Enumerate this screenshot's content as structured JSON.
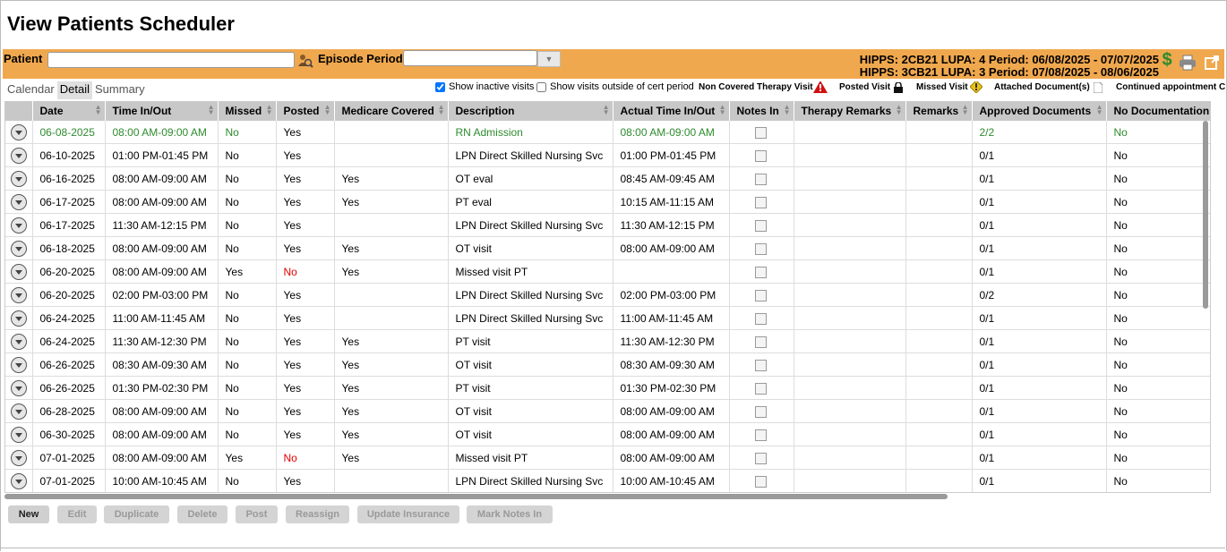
{
  "page": {
    "title": "View Patients Scheduler"
  },
  "filter": {
    "patient_label": "Patient",
    "patient_value": "",
    "episode_label": "Episode Period",
    "episode_value": "",
    "hipps_line1": "HIPPS: 2CB21 LUPA: 4 Period: 06/08/2025 - 07/07/2025",
    "hipps_line2": "HIPPS: 3CB21 LUPA: 3 Period: 07/08/2025 - 08/06/2025",
    "dollar_symbol": "$"
  },
  "tabs": [
    {
      "label": "Calendar",
      "active": false
    },
    {
      "label": "Detail",
      "active": true
    },
    {
      "label": "Summary",
      "active": false
    }
  ],
  "options": {
    "show_inactive_label": "Show inactive visits",
    "show_inactive_checked": true,
    "show_outside_label": "Show visits outside of cert period",
    "show_outside_checked": false,
    "legend_noncovered": "Non Covered Therapy Visit",
    "legend_posted": "Posted Visit",
    "legend_missed": "Missed Visit",
    "legend_attached": "Attached Document(s)",
    "legend_continued": "Continued appointment C"
  },
  "columns": [
    "Date",
    "Time In/Out",
    "Missed",
    "Posted",
    "Medicare Covered",
    "Description",
    "Actual Time In/Out",
    "Notes In",
    "Therapy Remarks",
    "Remarks",
    "Approved Documents",
    "No Documentation"
  ],
  "rows": [
    {
      "date": "06-08-2025",
      "time": "08:00 AM-09:00 AM",
      "missed": "No",
      "posted": "Yes",
      "medicare": "",
      "desc": "RN Admission",
      "actual": "08:00 AM-09:00 AM",
      "approved": "2/2",
      "nodoc": "No",
      "style": "green"
    },
    {
      "date": "06-10-2025",
      "time": "01:00 PM-01:45 PM",
      "missed": "No",
      "posted": "Yes",
      "medicare": "",
      "desc": "LPN Direct Skilled Nursing Svc",
      "actual": "01:00 PM-01:45 PM",
      "approved": "0/1",
      "nodoc": "No",
      "style": ""
    },
    {
      "date": "06-16-2025",
      "time": "08:00 AM-09:00 AM",
      "missed": "No",
      "posted": "Yes",
      "medicare": "Yes",
      "desc": "OT eval",
      "actual": "08:45 AM-09:45 AM",
      "approved": "0/1",
      "nodoc": "No",
      "style": ""
    },
    {
      "date": "06-17-2025",
      "time": "08:00 AM-09:00 AM",
      "missed": "No",
      "posted": "Yes",
      "medicare": "Yes",
      "desc": "PT eval",
      "actual": "10:15 AM-11:15 AM",
      "approved": "0/1",
      "nodoc": "No",
      "style": ""
    },
    {
      "date": "06-17-2025",
      "time": "11:30 AM-12:15 PM",
      "missed": "No",
      "posted": "Yes",
      "medicare": "",
      "desc": "LPN Direct Skilled Nursing Svc",
      "actual": "11:30 AM-12:15 PM",
      "approved": "0/1",
      "nodoc": "No",
      "style": ""
    },
    {
      "date": "06-18-2025",
      "time": "08:00 AM-09:00 AM",
      "missed": "No",
      "posted": "Yes",
      "medicare": "Yes",
      "desc": "OT visit",
      "actual": "08:00 AM-09:00 AM",
      "approved": "0/1",
      "nodoc": "No",
      "style": ""
    },
    {
      "date": "06-20-2025",
      "time": "08:00 AM-09:00 AM",
      "missed": "Yes",
      "posted": "No",
      "medicare": "Yes",
      "desc": "Missed visit PT",
      "actual": "",
      "approved": "0/1",
      "nodoc": "No",
      "style": "postedred"
    },
    {
      "date": "06-20-2025",
      "time": "02:00 PM-03:00 PM",
      "missed": "No",
      "posted": "Yes",
      "medicare": "",
      "desc": "LPN Direct Skilled Nursing Svc",
      "actual": "02:00 PM-03:00 PM",
      "approved": "0/2",
      "nodoc": "No",
      "style": ""
    },
    {
      "date": "06-24-2025",
      "time": "11:00 AM-11:45 AM",
      "missed": "No",
      "posted": "Yes",
      "medicare": "",
      "desc": "LPN Direct Skilled Nursing Svc",
      "actual": "11:00 AM-11:45 AM",
      "approved": "0/1",
      "nodoc": "No",
      "style": ""
    },
    {
      "date": "06-24-2025",
      "time": "11:30 AM-12:30 PM",
      "missed": "No",
      "posted": "Yes",
      "medicare": "Yes",
      "desc": "PT visit",
      "actual": "11:30 AM-12:30 PM",
      "approved": "0/1",
      "nodoc": "No",
      "style": ""
    },
    {
      "date": "06-26-2025",
      "time": "08:30 AM-09:30 AM",
      "missed": "No",
      "posted": "Yes",
      "medicare": "Yes",
      "desc": "OT visit",
      "actual": "08:30 AM-09:30 AM",
      "approved": "0/1",
      "nodoc": "No",
      "style": ""
    },
    {
      "date": "06-26-2025",
      "time": "01:30 PM-02:30 PM",
      "missed": "No",
      "posted": "Yes",
      "medicare": "Yes",
      "desc": "PT visit",
      "actual": "01:30 PM-02:30 PM",
      "approved": "0/1",
      "nodoc": "No",
      "style": ""
    },
    {
      "date": "06-28-2025",
      "time": "08:00 AM-09:00 AM",
      "missed": "No",
      "posted": "Yes",
      "medicare": "Yes",
      "desc": "OT visit",
      "actual": "08:00 AM-09:00 AM",
      "approved": "0/1",
      "nodoc": "No",
      "style": ""
    },
    {
      "date": "06-30-2025",
      "time": "08:00 AM-09:00 AM",
      "missed": "No",
      "posted": "Yes",
      "medicare": "Yes",
      "desc": "OT visit",
      "actual": "08:00 AM-09:00 AM",
      "approved": "0/1",
      "nodoc": "No",
      "style": ""
    },
    {
      "date": "07-01-2025",
      "time": "08:00 AM-09:00 AM",
      "missed": "Yes",
      "posted": "No",
      "medicare": "Yes",
      "desc": "Missed visit PT",
      "actual": "08:00 AM-09:00 AM",
      "approved": "0/1",
      "nodoc": "No",
      "style": "postedred"
    },
    {
      "date": "07-01-2025",
      "time": "10:00 AM-10:45 AM",
      "missed": "No",
      "posted": "Yes",
      "medicare": "",
      "desc": "LPN Direct Skilled Nursing Svc",
      "actual": "10:00 AM-10:45 AM",
      "approved": "0/1",
      "nodoc": "No",
      "style": ""
    }
  ],
  "buttons": [
    {
      "label": "New",
      "enabled": true
    },
    {
      "label": "Edit",
      "enabled": false
    },
    {
      "label": "Duplicate",
      "enabled": false
    },
    {
      "label": "Delete",
      "enabled": false
    },
    {
      "label": "Post",
      "enabled": false
    },
    {
      "label": "Reassign",
      "enabled": false
    },
    {
      "label": "Update Insurance",
      "enabled": false
    },
    {
      "label": "Mark Notes In",
      "enabled": false
    }
  ],
  "colors": {
    "filter_bar": "#f0a84e",
    "header": "#c8c8c8",
    "green_text": "#2e8b2e",
    "red_text": "#e00000",
    "dollar": "#2e8b2e"
  },
  "icons": [
    "person-search-icon",
    "combo-arrow-icon",
    "dollar-icon",
    "print-icon",
    "external-link-icon",
    "warning-triangle-icon",
    "lock-icon",
    "missed-diamond-icon",
    "document-icon",
    "row-expand-icon"
  ]
}
